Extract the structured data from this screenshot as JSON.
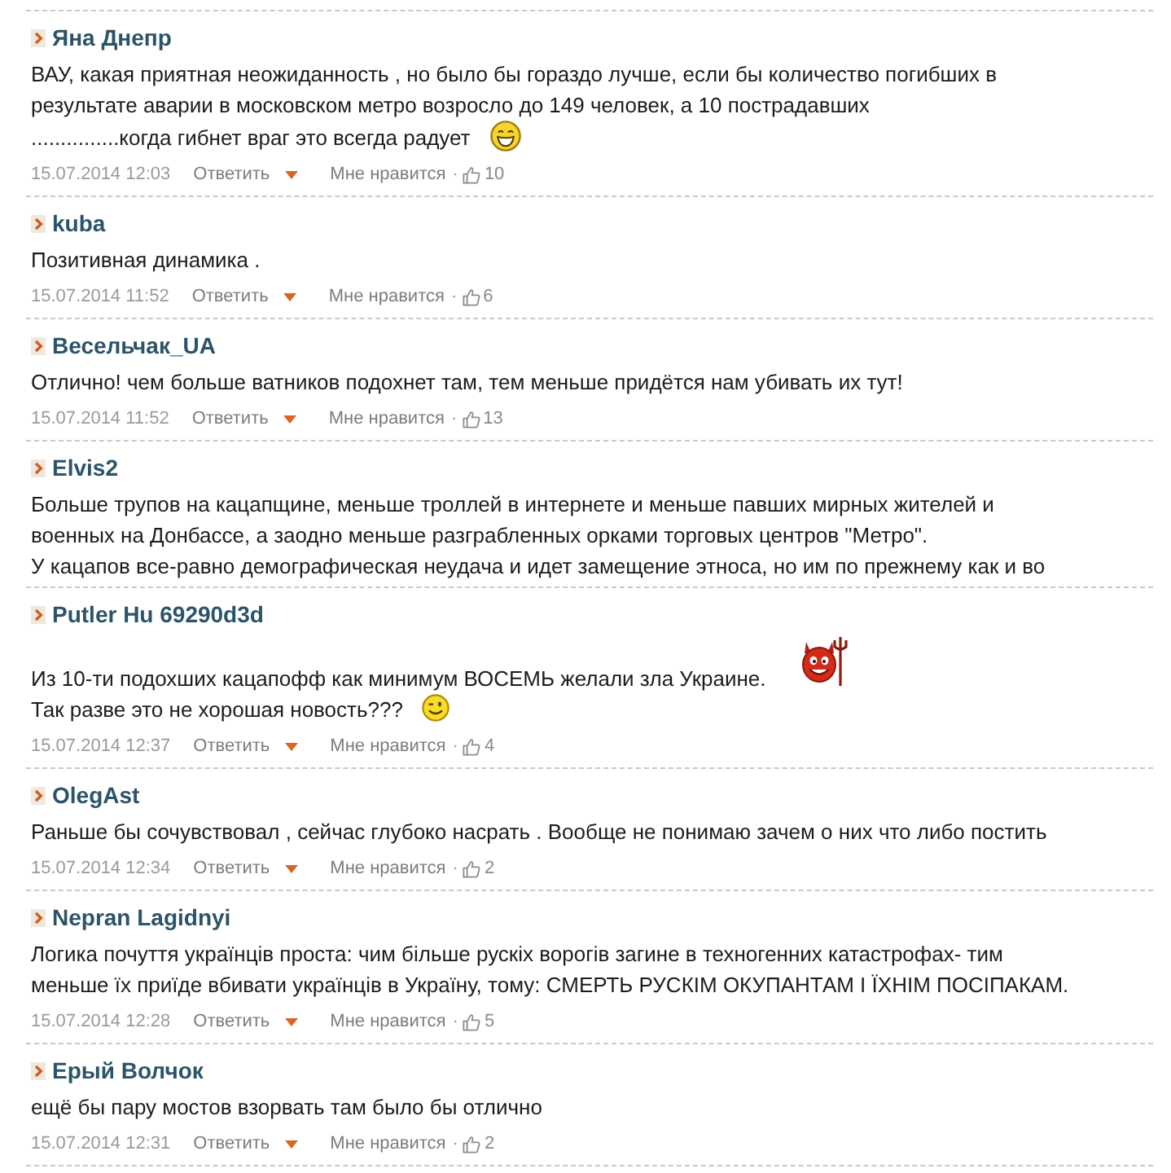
{
  "comments": [
    {
      "author": "Яна Днепр",
      "paragraphs": [
        {
          "text": "ВАУ, какая приятная неожиданность , но было бы гораздо лучше, если бы количество погибших в\nрезультате аварии в московском метро возросло до 149 человек, а 10 пострадавших"
        },
        {
          "text": "...............когда гибнет враг это всегда радует",
          "emoticon": {
            "kind": "laugh"
          }
        }
      ],
      "date": "15.07.2014 12:03",
      "reply": "Ответить",
      "like": "Мне нравится",
      "dot": "·",
      "likes": "10"
    },
    {
      "author": "kuba",
      "paragraphs": [
        {
          "text": "Позитивная динамика ."
        }
      ],
      "date": "15.07.2014 11:52",
      "reply": "Ответить",
      "like": "Мне нравится",
      "dot": "·",
      "likes": "6"
    },
    {
      "author": "Весельчак_UA",
      "paragraphs": [
        {
          "text": "Отлично! чем больше ватников подохнет там, тем меньше придётся нам убивать их тут!"
        }
      ],
      "date": "15.07.2014 11:52",
      "reply": "Ответить",
      "like": "Мне нравится",
      "dot": "·",
      "likes": "13"
    },
    {
      "author": "Elvis2",
      "paragraphs": [
        {
          "text": "Больше трупов на кацапщине, меньше троллей в интернете и меньше павших мирных жителей и\nвоенных на Донбассе, а заодно меньше разграбленных орками торговых центров \"Метро\".\nУ кацапов все-равно демографическая неудача и идет замещение этноса, но им по прежнему как и во"
        }
      ]
    },
    {
      "author": "Putler Hu 69290d3d",
      "paragraphs": [
        {
          "text": "Из 10-ти подохших кацапофф как минимум ВОСЕМЬ желали зла Украине.",
          "emoticon": {
            "kind": "devil"
          }
        },
        {
          "text": "Так разве это не хорошая новость???",
          "emoticon": {
            "kind": "wink"
          }
        }
      ],
      "date": "15.07.2014 12:37",
      "reply": "Ответить",
      "like": "Мне нравится",
      "dot": "·",
      "likes": "4"
    },
    {
      "author": "OlegAst",
      "paragraphs": [
        {
          "text": "Раньше бы сочувствовал , сейчас глубоко насрать . Вообще не понимаю зачем о них что либо постить"
        }
      ],
      "date": "15.07.2014 12:34",
      "reply": "Ответить",
      "like": "Мне нравится",
      "dot": "·",
      "likes": "2"
    },
    {
      "author": "Nepran Lagidnyi",
      "paragraphs": [
        {
          "text": "Логика почуття українців проста: чим більше рускіх ворогів загине в техногенних катастрофах- тим\nменьше їх приїде вбивати українців в Україну, тому: СМЕРТЬ РУСКІМ ОКУПАНТАМ І ЇХНІМ ПОСІПАКАМ."
        }
      ],
      "date": "15.07.2014 12:28",
      "reply": "Ответить",
      "like": "Мне нравится",
      "dot": "·",
      "likes": "5"
    },
    {
      "author": "Ерый Волчок",
      "paragraphs": [
        {
          "text": "ещё бы пару мостов взорвать там было бы отлично"
        }
      ],
      "date": "15.07.2014 12:31",
      "reply": "Ответить",
      "like": "Мне нравится",
      "dot": "·",
      "likes": "2"
    }
  ]
}
